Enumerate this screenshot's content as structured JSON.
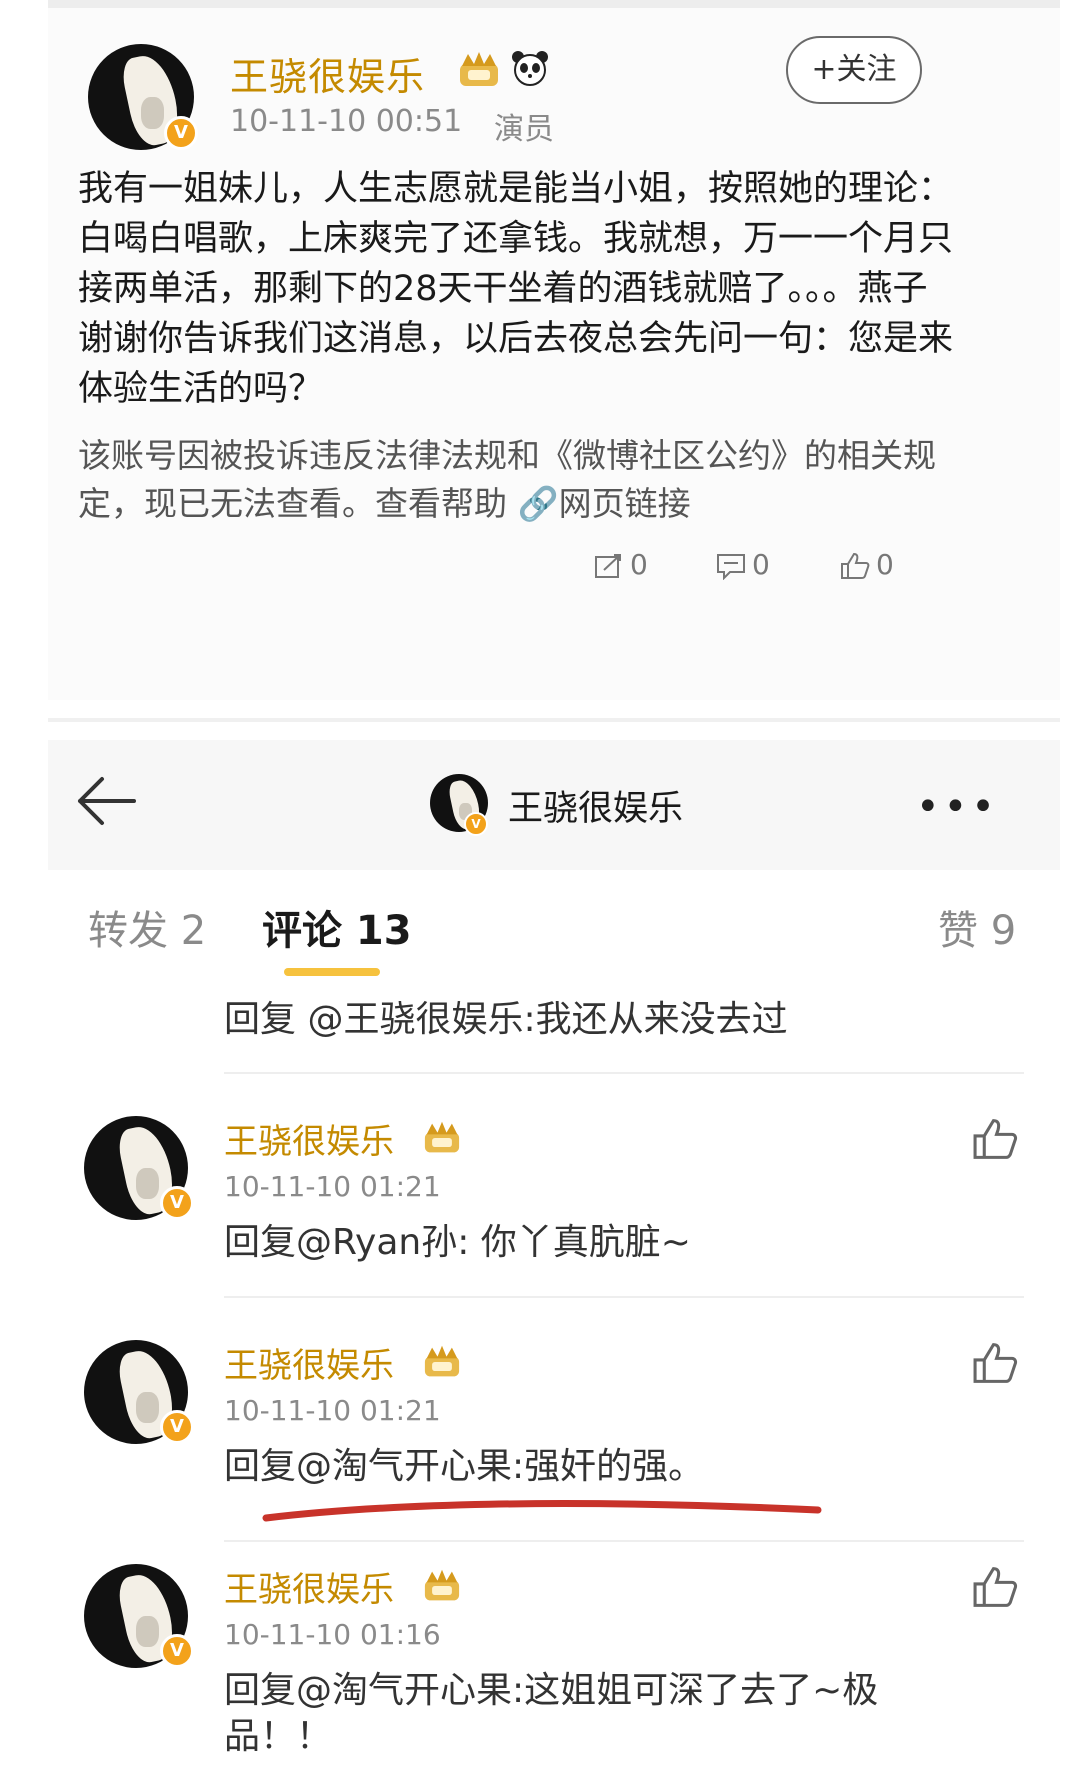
{
  "post": {
    "author": "王骁很娱乐",
    "timestamp": "10-11-10 00:51",
    "role": "演员",
    "follow_label": "+关注",
    "verified_badge": "V",
    "body": "我有一姐妹儿，人生志愿就是能当小姐，按照她的理论：白喝白唱歌，上床爽完了还拿钱。我就想，万一一个月只接两单活，那剩下的28天干坐着的酒钱就赔了。。。燕子谢谢你告诉我们这消息，以后去夜总会先问一句：您是来体验生活的吗？",
    "notice": "该账号因被投诉违反法律法规和《微博社区公约》的相关规定，现已无法查看。查看帮助",
    "notice_link": "网页链接",
    "repost_count": "0",
    "comment_count": "0",
    "like_count": "0"
  },
  "navbar": {
    "title": "王骁很娱乐",
    "more": "•••"
  },
  "tabs": {
    "forward": "转发 2",
    "comments": "评论 13",
    "likes": "赞 9"
  },
  "first_reply": "回复 @王骁很娱乐:我还从来没去过",
  "comments": [
    {
      "author": "王骁很娱乐",
      "time": "10-11-10 01:21",
      "text": "回复@Ryan孙: 你丫真肮脏~"
    },
    {
      "author": "王骁很娱乐",
      "time": "10-11-10 01:21",
      "text": "回复@淘气开心果:强奸的强。"
    },
    {
      "author": "王骁很娱乐",
      "time": "10-11-10 01:16",
      "text": "回复@淘气开心果:这姐姐可深了去了~极品！！"
    }
  ],
  "colors": {
    "username": "#c48a00",
    "tab_underline": "#f6c23e",
    "verified_badge": "#f3a21b",
    "annotation_underline": "#c8332a"
  },
  "icons": [
    "back-arrow-icon",
    "more-icon",
    "crown-icon",
    "panda-icon",
    "repost-icon",
    "comment-icon",
    "like-icon",
    "link-icon",
    "verified-badge-icon"
  ]
}
